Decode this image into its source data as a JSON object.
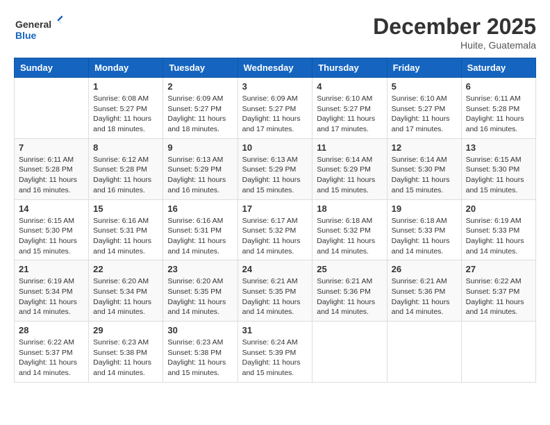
{
  "logo": {
    "text_general": "General",
    "text_blue": "Blue",
    "arrow_color": "#1565C0"
  },
  "title": "December 2025",
  "location": "Huite, Guatemala",
  "header_days": [
    "Sunday",
    "Monday",
    "Tuesday",
    "Wednesday",
    "Thursday",
    "Friday",
    "Saturday"
  ],
  "weeks": [
    [
      {
        "day": "",
        "info": ""
      },
      {
        "day": "1",
        "info": "Sunrise: 6:08 AM\nSunset: 5:27 PM\nDaylight: 11 hours\nand 18 minutes."
      },
      {
        "day": "2",
        "info": "Sunrise: 6:09 AM\nSunset: 5:27 PM\nDaylight: 11 hours\nand 18 minutes."
      },
      {
        "day": "3",
        "info": "Sunrise: 6:09 AM\nSunset: 5:27 PM\nDaylight: 11 hours\nand 17 minutes."
      },
      {
        "day": "4",
        "info": "Sunrise: 6:10 AM\nSunset: 5:27 PM\nDaylight: 11 hours\nand 17 minutes."
      },
      {
        "day": "5",
        "info": "Sunrise: 6:10 AM\nSunset: 5:27 PM\nDaylight: 11 hours\nand 17 minutes."
      },
      {
        "day": "6",
        "info": "Sunrise: 6:11 AM\nSunset: 5:28 PM\nDaylight: 11 hours\nand 16 minutes."
      }
    ],
    [
      {
        "day": "7",
        "info": "Sunrise: 6:11 AM\nSunset: 5:28 PM\nDaylight: 11 hours\nand 16 minutes."
      },
      {
        "day": "8",
        "info": "Sunrise: 6:12 AM\nSunset: 5:28 PM\nDaylight: 11 hours\nand 16 minutes."
      },
      {
        "day": "9",
        "info": "Sunrise: 6:13 AM\nSunset: 5:29 PM\nDaylight: 11 hours\nand 16 minutes."
      },
      {
        "day": "10",
        "info": "Sunrise: 6:13 AM\nSunset: 5:29 PM\nDaylight: 11 hours\nand 15 minutes."
      },
      {
        "day": "11",
        "info": "Sunrise: 6:14 AM\nSunset: 5:29 PM\nDaylight: 11 hours\nand 15 minutes."
      },
      {
        "day": "12",
        "info": "Sunrise: 6:14 AM\nSunset: 5:30 PM\nDaylight: 11 hours\nand 15 minutes."
      },
      {
        "day": "13",
        "info": "Sunrise: 6:15 AM\nSunset: 5:30 PM\nDaylight: 11 hours\nand 15 minutes."
      }
    ],
    [
      {
        "day": "14",
        "info": "Sunrise: 6:15 AM\nSunset: 5:30 PM\nDaylight: 11 hours\nand 15 minutes."
      },
      {
        "day": "15",
        "info": "Sunrise: 6:16 AM\nSunset: 5:31 PM\nDaylight: 11 hours\nand 14 minutes."
      },
      {
        "day": "16",
        "info": "Sunrise: 6:16 AM\nSunset: 5:31 PM\nDaylight: 11 hours\nand 14 minutes."
      },
      {
        "day": "17",
        "info": "Sunrise: 6:17 AM\nSunset: 5:32 PM\nDaylight: 11 hours\nand 14 minutes."
      },
      {
        "day": "18",
        "info": "Sunrise: 6:18 AM\nSunset: 5:32 PM\nDaylight: 11 hours\nand 14 minutes."
      },
      {
        "day": "19",
        "info": "Sunrise: 6:18 AM\nSunset: 5:33 PM\nDaylight: 11 hours\nand 14 minutes."
      },
      {
        "day": "20",
        "info": "Sunrise: 6:19 AM\nSunset: 5:33 PM\nDaylight: 11 hours\nand 14 minutes."
      }
    ],
    [
      {
        "day": "21",
        "info": "Sunrise: 6:19 AM\nSunset: 5:34 PM\nDaylight: 11 hours\nand 14 minutes."
      },
      {
        "day": "22",
        "info": "Sunrise: 6:20 AM\nSunset: 5:34 PM\nDaylight: 11 hours\nand 14 minutes."
      },
      {
        "day": "23",
        "info": "Sunrise: 6:20 AM\nSunset: 5:35 PM\nDaylight: 11 hours\nand 14 minutes."
      },
      {
        "day": "24",
        "info": "Sunrise: 6:21 AM\nSunset: 5:35 PM\nDaylight: 11 hours\nand 14 minutes."
      },
      {
        "day": "25",
        "info": "Sunrise: 6:21 AM\nSunset: 5:36 PM\nDaylight: 11 hours\nand 14 minutes."
      },
      {
        "day": "26",
        "info": "Sunrise: 6:21 AM\nSunset: 5:36 PM\nDaylight: 11 hours\nand 14 minutes."
      },
      {
        "day": "27",
        "info": "Sunrise: 6:22 AM\nSunset: 5:37 PM\nDaylight: 11 hours\nand 14 minutes."
      }
    ],
    [
      {
        "day": "28",
        "info": "Sunrise: 6:22 AM\nSunset: 5:37 PM\nDaylight: 11 hours\nand 14 minutes."
      },
      {
        "day": "29",
        "info": "Sunrise: 6:23 AM\nSunset: 5:38 PM\nDaylight: 11 hours\nand 14 minutes."
      },
      {
        "day": "30",
        "info": "Sunrise: 6:23 AM\nSunset: 5:38 PM\nDaylight: 11 hours\nand 15 minutes."
      },
      {
        "day": "31",
        "info": "Sunrise: 6:24 AM\nSunset: 5:39 PM\nDaylight: 11 hours\nand 15 minutes."
      },
      {
        "day": "",
        "info": ""
      },
      {
        "day": "",
        "info": ""
      },
      {
        "day": "",
        "info": ""
      }
    ]
  ]
}
